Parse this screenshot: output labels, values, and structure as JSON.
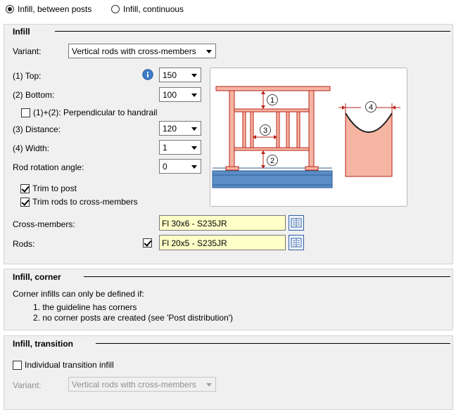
{
  "mode": {
    "between_posts": "Infill, between posts",
    "continuous": "Infill, continuous"
  },
  "infill": {
    "title": "Infill",
    "variant_label": "Variant:",
    "variant_value": "Vertical rods with cross-members",
    "top_label": "(1) Top:",
    "top_value": "150",
    "bottom_label": "(2) Bottom:",
    "bottom_value": "100",
    "perpendicular_label": "(1)+(2): Perpendicular to handrail",
    "distance_label": "(3) Distance:",
    "distance_value": "120",
    "width_label": "(4) Width:",
    "width_value": "1",
    "rotation_label": "Rod rotation angle:",
    "rotation_value": "0",
    "trim_post_label": "Trim to post",
    "trim_rods_label": "Trim rods to cross-members",
    "cross_members_label": "Cross-members:",
    "cross_members_value": "Fl 30x6 - S235JR",
    "rods_label": "Rods:",
    "rods_value": "Fl 20x5 - S235JR",
    "diagram_labels": [
      "1",
      "2",
      "3",
      "4"
    ]
  },
  "corner": {
    "title": "Infill, corner",
    "intro": "Corner infills can only be defined if:",
    "item1": "1. the guideline has corners",
    "item2": "2. no corner posts are created (see 'Post distribution')"
  },
  "transition": {
    "title": "Infill, transition",
    "individual_label": "Individual transition infill",
    "variant_label": "Variant:",
    "variant_value": "Vertical rods with cross-members"
  },
  "colors": {
    "panel": "#f0f0f0",
    "profile_field": "#ffffc8",
    "rail_fill": "#f6b5a3",
    "rail_stroke": "#b8231a",
    "ground_fill": "#5b8ec7"
  }
}
